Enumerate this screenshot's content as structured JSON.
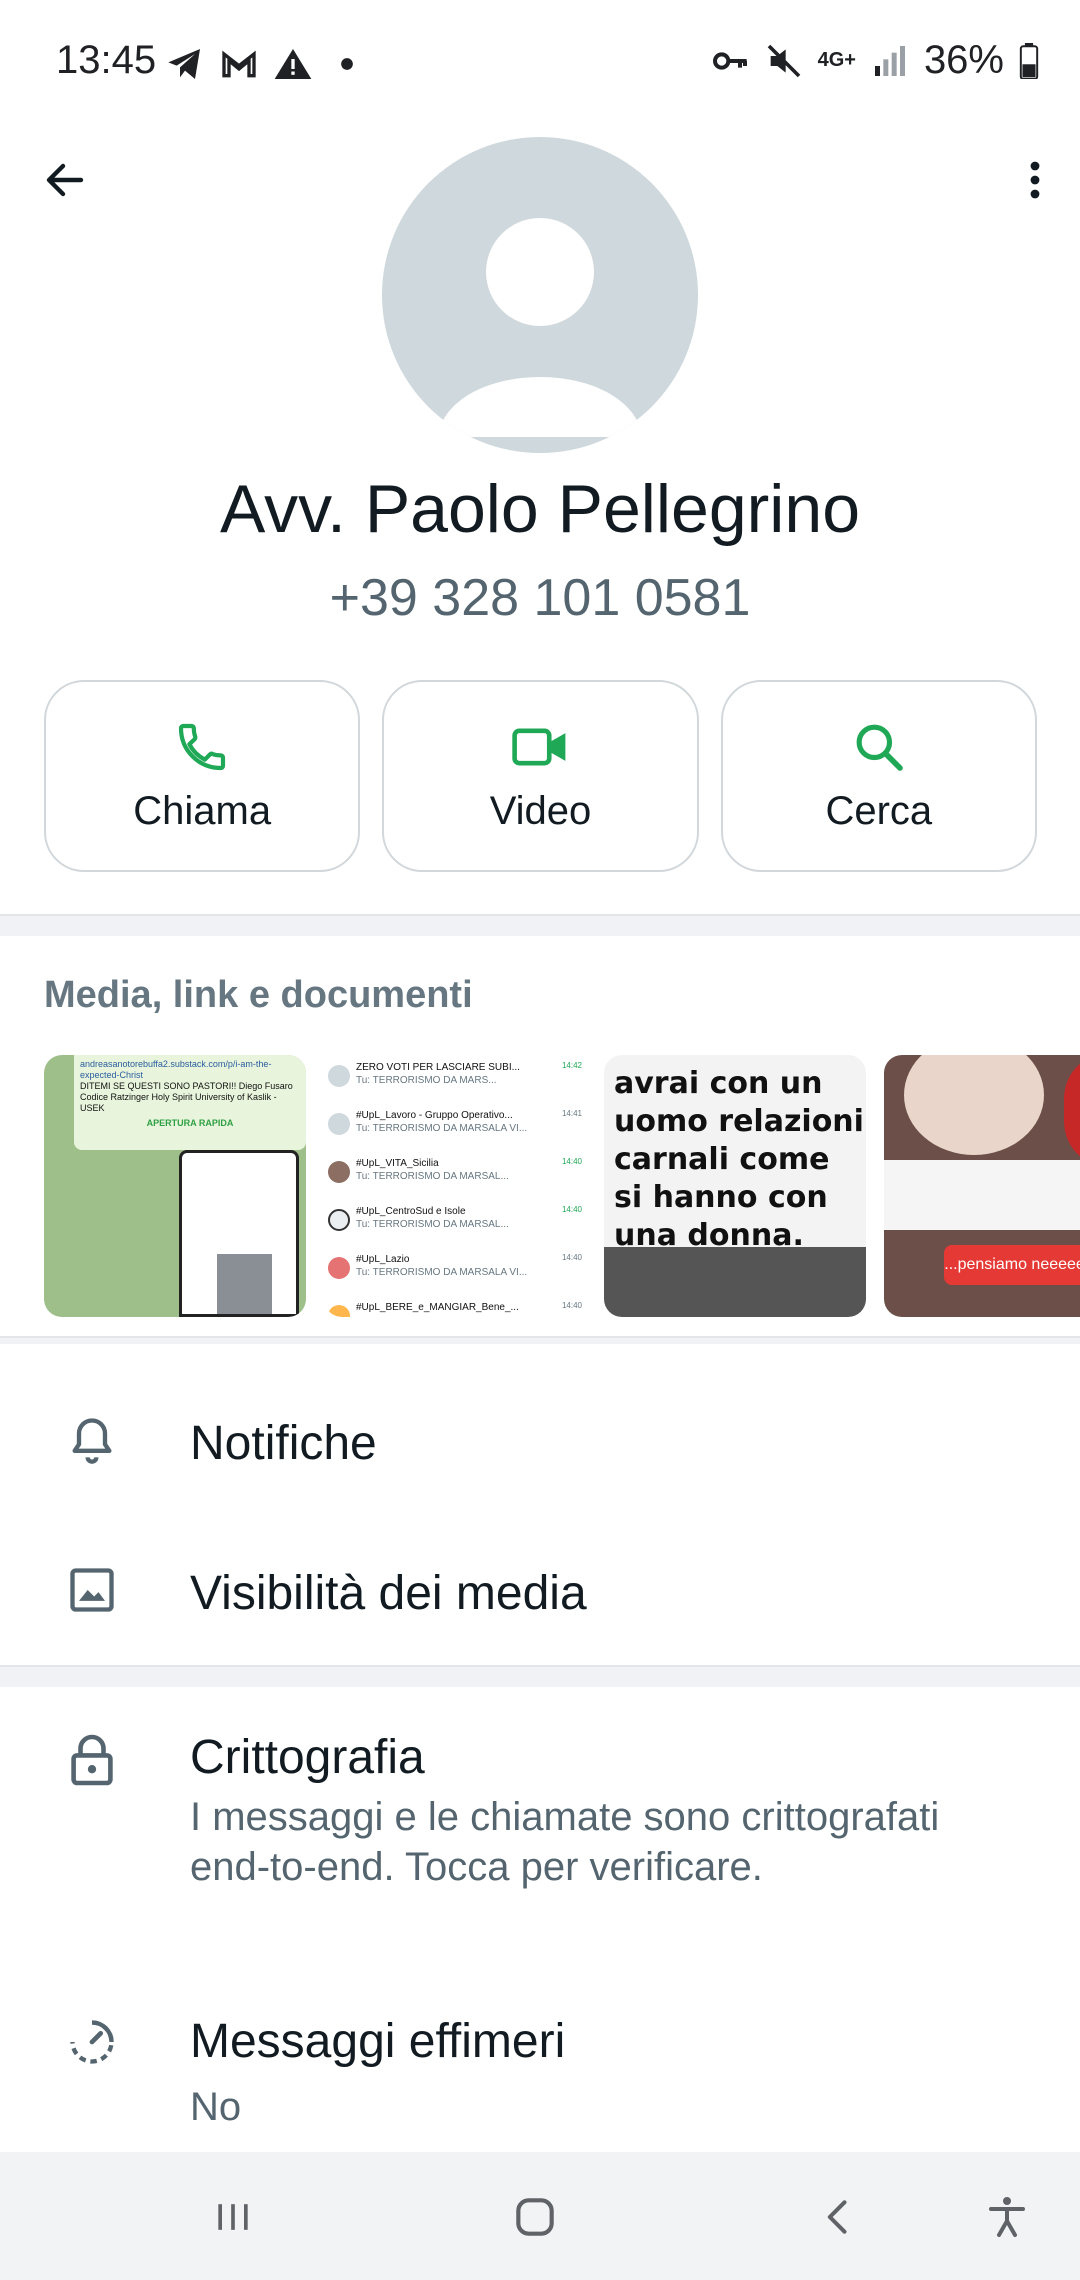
{
  "status_bar": {
    "time": "13:45",
    "battery": "36%",
    "network": "4G+",
    "left_icons": [
      "telegram-icon",
      "gmail-icon",
      "alert-icon",
      "dot-icon"
    ],
    "right_icons": [
      "vpn-key-icon",
      "mute-icon",
      "network-4g-icon",
      "signal-icon",
      "battery-icon"
    ]
  },
  "header": {
    "back_icon": "back-arrow-icon",
    "menu_icon": "more-vert-icon"
  },
  "contact": {
    "name": "Avv. Paolo Pellegrino",
    "phone": "+39 328 101 0581"
  },
  "actions": [
    {
      "label": "Chiama",
      "icon": "phone-icon"
    },
    {
      "label": "Video",
      "icon": "video-icon"
    },
    {
      "label": "Cerca",
      "icon": "search-icon"
    }
  ],
  "media": {
    "title": "Media, link e documenti",
    "thumb1": {
      "line1": "andreasanotorebuffa2.substack.com/p/i-am-the-expected-Christ",
      "line2": "DITEMI SE QUESTI SONO PASTORI!! Diego Fusaro Codice Ratzinger Holy Spirit University of Kaslik - USEK",
      "line3": "APERTURA RAPIDA"
    },
    "thumb2_rows": [
      {
        "title": "ZERO VOTI PER LASCIARE SUBI...",
        "sub": "Tu: TERRORISMO DA MARS...",
        "time": "14:42"
      },
      {
        "title": "#UpL_Lavoro - Gruppo Operativo...",
        "sub": "Tu: TERRORISMO DA MARSALA VI...",
        "time": "14:41"
      },
      {
        "title": "#UpL_VITA_Sicilia",
        "sub": "Tu: TERRORISMO DA MARSAL...",
        "time": "14:40"
      },
      {
        "title": "#UpL_CentroSud e Isole",
        "sub": "Tu: TERRORISMO DA MARSAL...",
        "time": "14:40"
      },
      {
        "title": "#UpL_Lazio",
        "sub": "Tu: TERRORISMO DA MARSALA VI...",
        "time": "14:40"
      },
      {
        "title": "#UpL_BERE_e_MANGIAR_Bene_...",
        "sub": "",
        "time": "14:40"
      }
    ],
    "thumb3_text": "avrai con un uomo relazioni carnali come si hanno con una donna.",
    "thumb4_text": "...pensiamo neeeeee"
  },
  "list": {
    "notifications": {
      "title": "Notifiche",
      "icon": "bell-icon"
    },
    "media_visibility": {
      "title": "Visibilità dei media",
      "icon": "image-icon"
    },
    "encryption": {
      "title": "Crittografia",
      "subtitle": "I messaggi e le chiamate sono crittografati end-to-end. Tocca per verificare.",
      "icon": "lock-icon"
    },
    "ephemeral": {
      "title": "Messaggi effimeri",
      "subtitle": "No",
      "icon": "timer-icon"
    }
  },
  "nav_bar": {
    "buttons": [
      "recents-icon",
      "home-icon",
      "back-icon",
      "accessibility-icon"
    ]
  },
  "colors": {
    "accent_green": "#1fa855",
    "avatar_bg": "#cfd8dc",
    "text_secondary": "#54656f"
  }
}
